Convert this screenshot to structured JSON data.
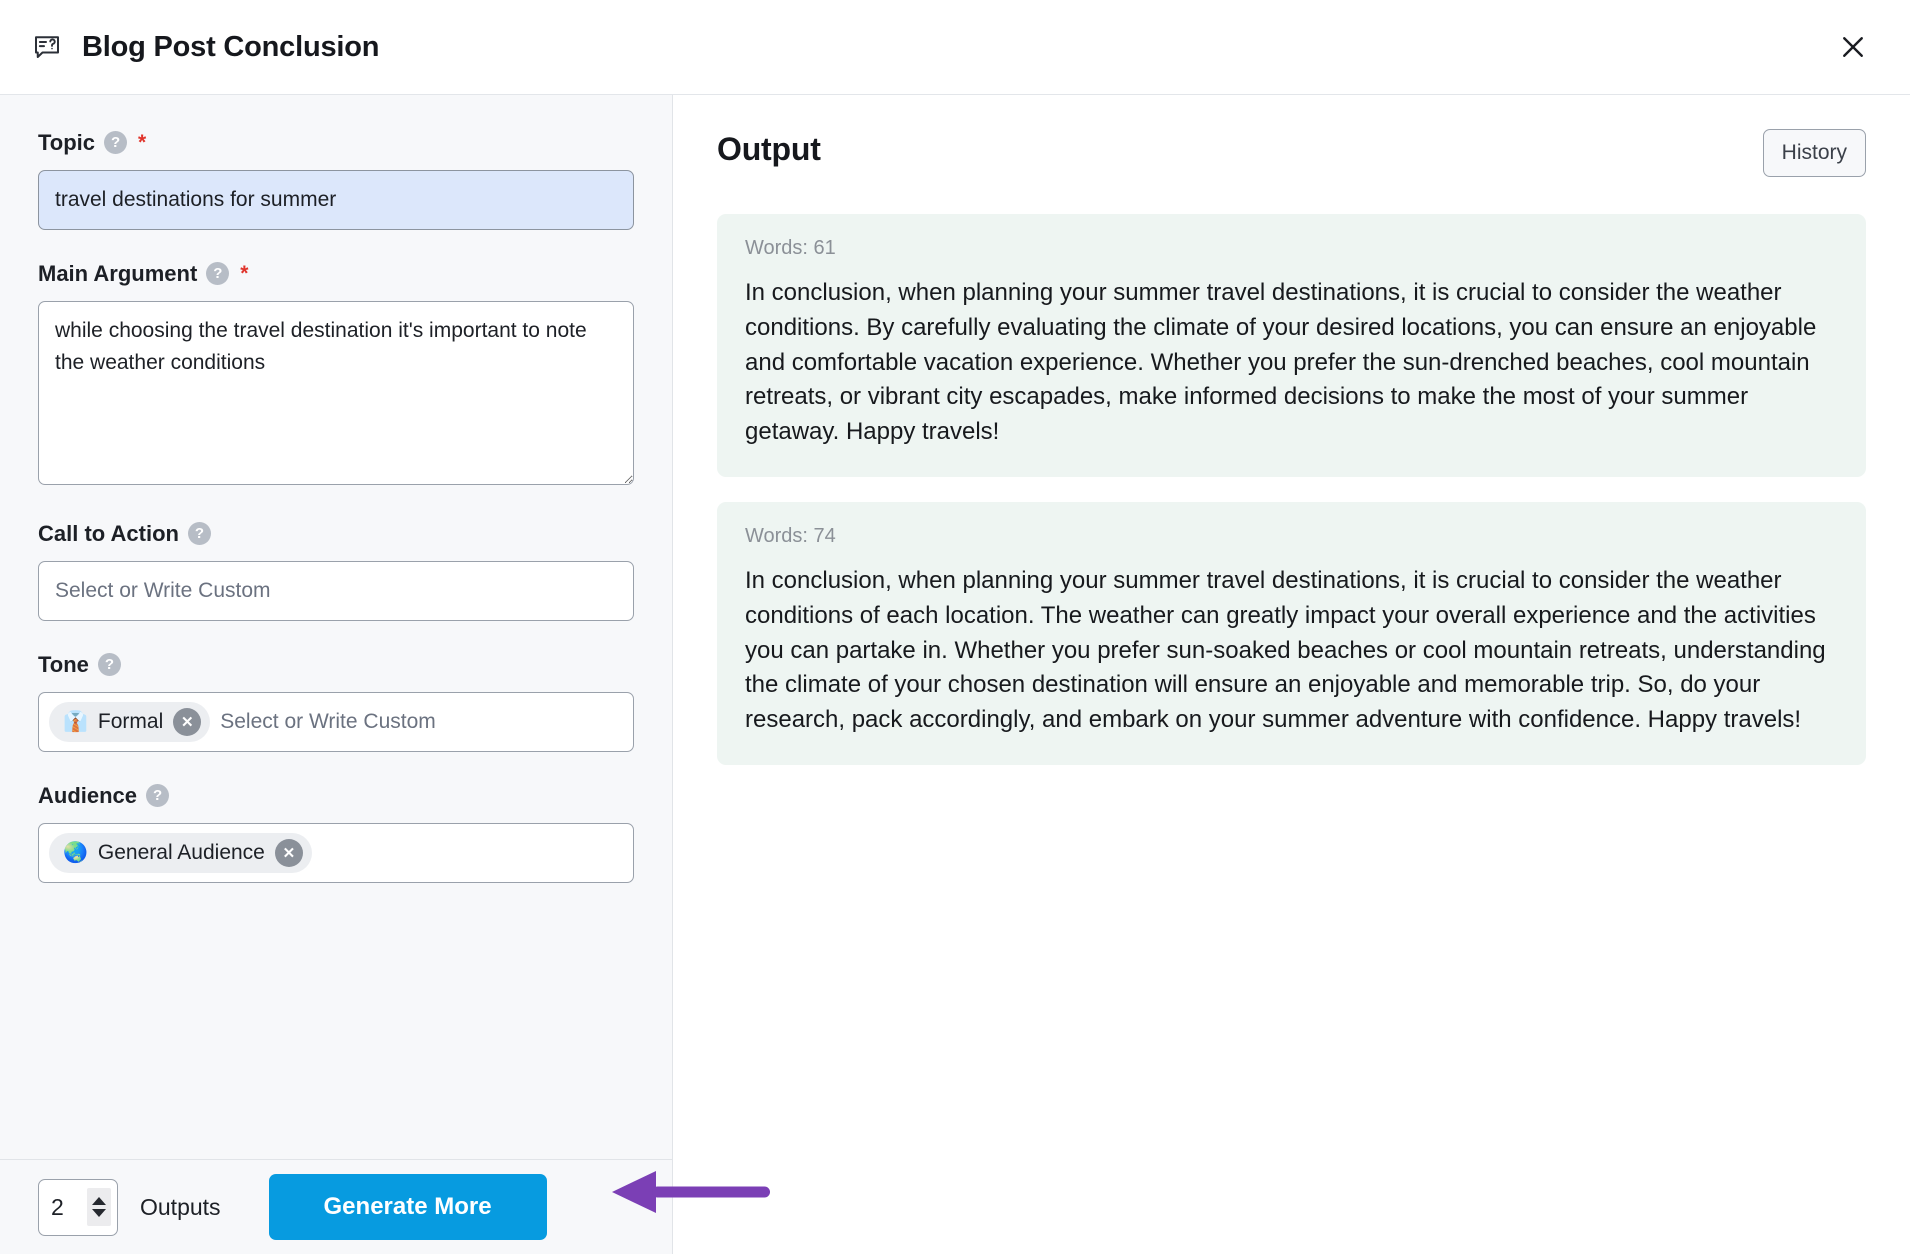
{
  "header": {
    "title": "Blog Post Conclusion",
    "icon": "speech-bubble-question-icon",
    "close_label": "✕"
  },
  "form": {
    "fields": [
      {
        "label": "Topic",
        "help": "?",
        "required": "*",
        "type": "text",
        "value": "travel destinations for summer",
        "placeholder": "",
        "focused": true
      },
      {
        "label": "Main Argument",
        "help": "?",
        "required": "*",
        "type": "textarea",
        "value": "while choosing the travel destination it's important to note the weather conditions",
        "placeholder": ""
      },
      {
        "label": "Call to Action",
        "help": "?",
        "required": "",
        "type": "text",
        "value": "",
        "placeholder": "Select or Write Custom"
      },
      {
        "label": "Tone",
        "help": "?",
        "required": "",
        "type": "tags",
        "placeholder": "Select or Write Custom",
        "chips": [
          {
            "emoji": "👔",
            "label": "Formal",
            "remove": "✕"
          }
        ]
      },
      {
        "label": "Audience",
        "help": "?",
        "required": "",
        "type": "tags",
        "placeholder": "",
        "chips": [
          {
            "emoji": "🌏",
            "label": "General Audience",
            "remove": "✕"
          }
        ]
      }
    ]
  },
  "footer": {
    "outputs_count": "2",
    "outputs_label": "Outputs",
    "generate_label": "Generate More",
    "generate_color": "#079be0"
  },
  "output": {
    "title": "Output",
    "history_label": "History",
    "cards": [
      {
        "words_label": "Words: 61",
        "text": "In conclusion, when planning your summer travel destinations, it is crucial to consider the weather conditions. By carefully evaluating the climate of your desired locations, you can ensure an enjoyable and comfortable vacation experience. Whether you prefer the sun-drenched beaches, cool mountain retreats, or vibrant city escapades, make informed decisions to make the most of your summer getaway. Happy travels!"
      },
      {
        "words_label": "Words: 74",
        "text": "In conclusion, when planning your summer travel destinations, it is crucial to consider the weather conditions of each location. The weather can greatly impact your overall experience and the activities you can partake in. Whether you prefer sun-soaked beaches or cool mountain retreats, understanding the climate of your chosen destination will ensure an enjoyable and memorable trip. So, do your research, pack accordingly, and embark on your summer adventure with confidence. Happy travels!"
      }
    ]
  },
  "annotation": {
    "arrow_color": "#7b3fb5",
    "points_to": "Generate More"
  }
}
